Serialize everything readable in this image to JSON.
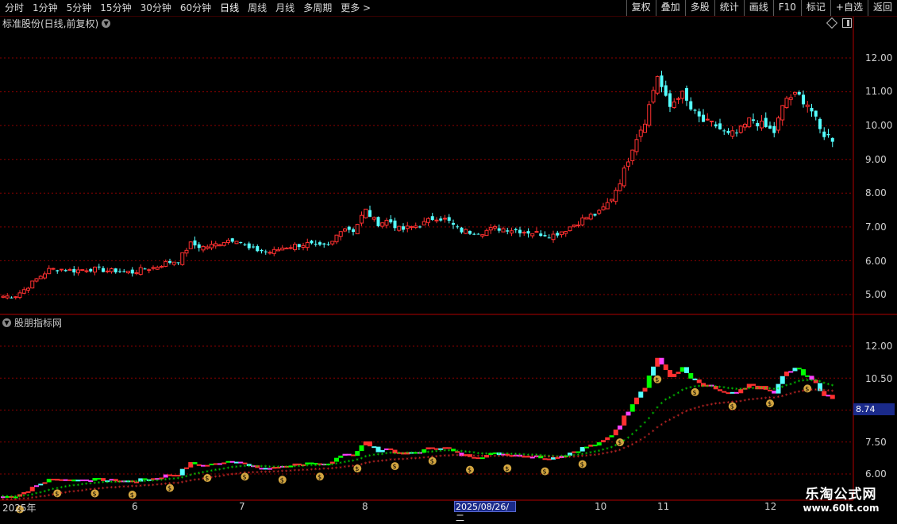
{
  "toolbar": {
    "periods": [
      "分时",
      "1分钟",
      "5分钟",
      "15分钟",
      "30分钟",
      "60分钟",
      "日线",
      "周线",
      "月线",
      "多周期",
      "更多 >"
    ],
    "active_period": "日线",
    "actions": [
      "复权",
      "叠加",
      "多股",
      "统计",
      "画线",
      "F10",
      "标记",
      "+自选",
      "返回"
    ]
  },
  "main_panel": {
    "title": "标准股份(日线,前复权)",
    "price_axis": [
      "12.00",
      "11.00",
      "10.00",
      "9.00",
      "8.00",
      "7.00",
      "6.00",
      "5.00"
    ]
  },
  "indicator_panel": {
    "title": "股朋指标网",
    "axis": [
      "12.00",
      "10.50",
      "7.50",
      "6.00"
    ],
    "current_value": "8.74"
  },
  "date_axis": {
    "labels": [
      "2025年",
      "6",
      "7",
      "8",
      "10",
      "11",
      "12"
    ],
    "selected_date": "2025/08/26/二"
  },
  "watermark": {
    "line1": "乐淘公式网",
    "line2": "www.60lt.com"
  },
  "colors": {
    "up": "#ff3030",
    "down": "#54ffff",
    "grid": "#8a0000",
    "axis_line": "#b00000",
    "green": "#00ff00",
    "magenta": "#ff40ff"
  },
  "chart_data": {
    "type": "candlestick",
    "y_range": [
      4.6,
      12.9
    ],
    "closes_sampled": [
      4.95,
      4.95,
      5.2,
      5.5,
      5.75,
      5.75,
      5.7,
      5.75,
      5.75,
      5.7,
      5.7,
      5.65,
      5.75,
      5.8,
      5.95,
      6.0,
      6.5,
      6.4,
      6.45,
      6.6,
      6.65,
      6.35,
      6.3,
      6.25,
      6.4,
      6.45,
      6.5,
      6.4,
      6.45,
      7.0,
      6.9,
      7.5,
      7.1,
      7.2,
      6.9,
      7.0,
      7.1,
      7.3,
      7.2,
      6.9,
      6.85,
      6.85,
      6.95,
      6.95,
      6.9,
      6.85,
      6.8,
      6.75,
      6.9,
      7.1,
      7.3,
      7.4,
      7.8,
      8.5,
      9.5,
      10.2,
      11.5,
      10.5,
      11.0,
      10.4,
      10.1,
      10.0,
      9.7,
      9.8,
      10.2,
      10.0,
      9.8,
      10.8,
      10.9,
      10.6,
      9.8,
      9.6
    ]
  }
}
